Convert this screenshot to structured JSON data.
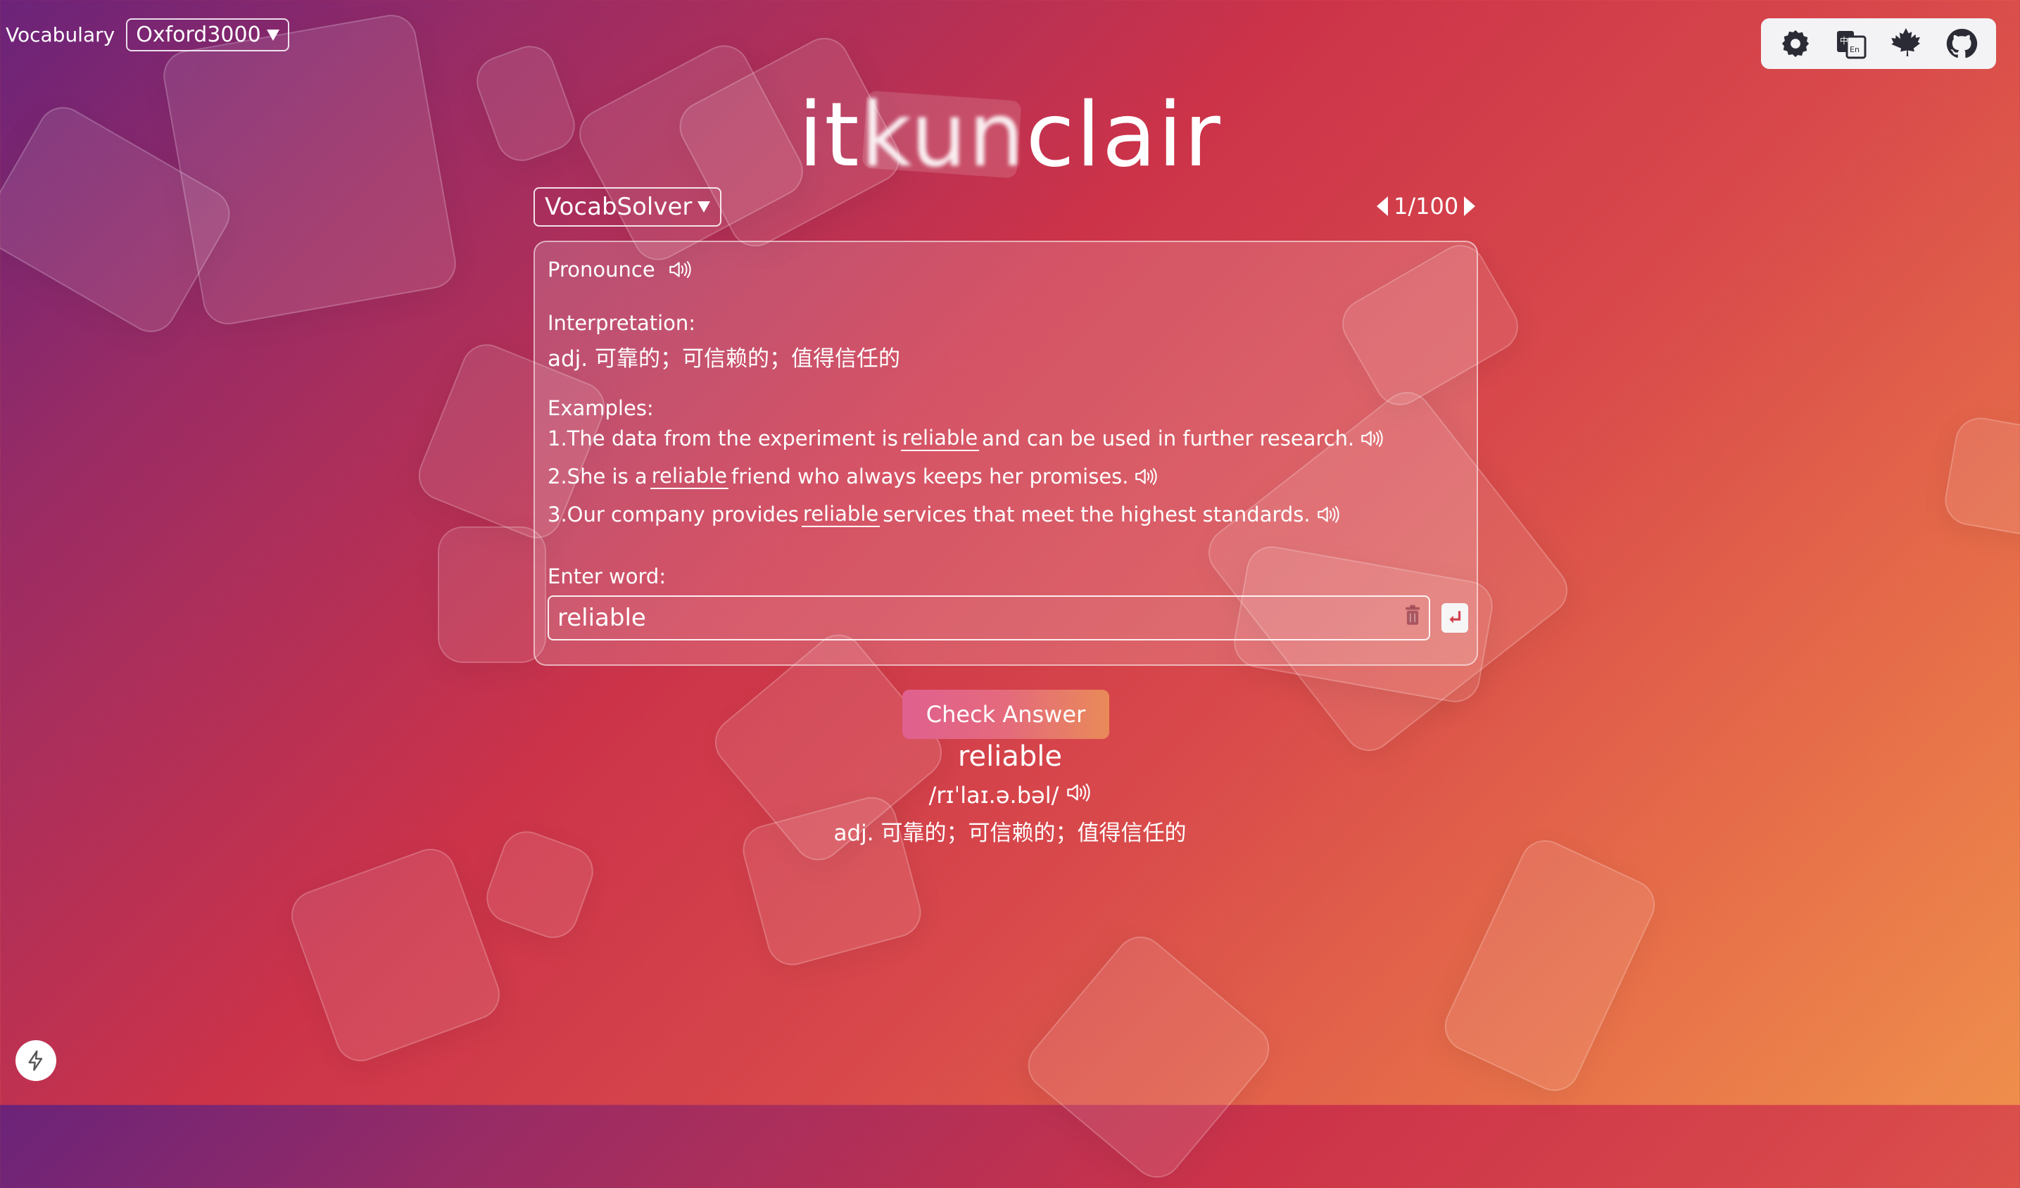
{
  "header": {
    "vocabulary_label": "Vocabulary",
    "vocabulary_selected": "Oxford3000"
  },
  "toolbar": {
    "icons": [
      "settings-icon",
      "translate-icon",
      "maple-leaf-icon",
      "github-icon"
    ],
    "translate_badge": "中En"
  },
  "title": {
    "part1": "it",
    "part2": "kun",
    "part3": "clair"
  },
  "solver": {
    "selected": "VocabSolver"
  },
  "pager": {
    "text": "1/100"
  },
  "panel": {
    "pronounce_label": "Pronounce",
    "interpretation_label": "Interpretation:",
    "interpretation_pos": "adj.",
    "interpretation_text": "可靠的；可信赖的；值得信任的",
    "examples_label": "Examples:",
    "examples": [
      {
        "num": "1.",
        "before": "The data from the experiment is",
        "word": "reliable",
        "after": "and can be used in further research."
      },
      {
        "num": "2.",
        "before": "She is a",
        "word": "reliable",
        "after": "friend who always keeps her promises."
      },
      {
        "num": "3.",
        "before": "Our company provides",
        "word": "reliable",
        "after": "services that meet the highest standards."
      }
    ],
    "enter_label": "Enter word:",
    "input_value": "reliable"
  },
  "check_button": "Check Answer",
  "result": {
    "word": "reliable",
    "phonetic": "/rɪˈlaɪ.ə.bəl/",
    "pos": "adj.",
    "definition": "可靠的；可信赖的；值得信任的"
  },
  "colors": {
    "bg_start": "#6b2379",
    "bg_mid": "#cc3349",
    "bg_end": "#ef8e4c",
    "toolbar_bg": "#f3f3f6"
  }
}
